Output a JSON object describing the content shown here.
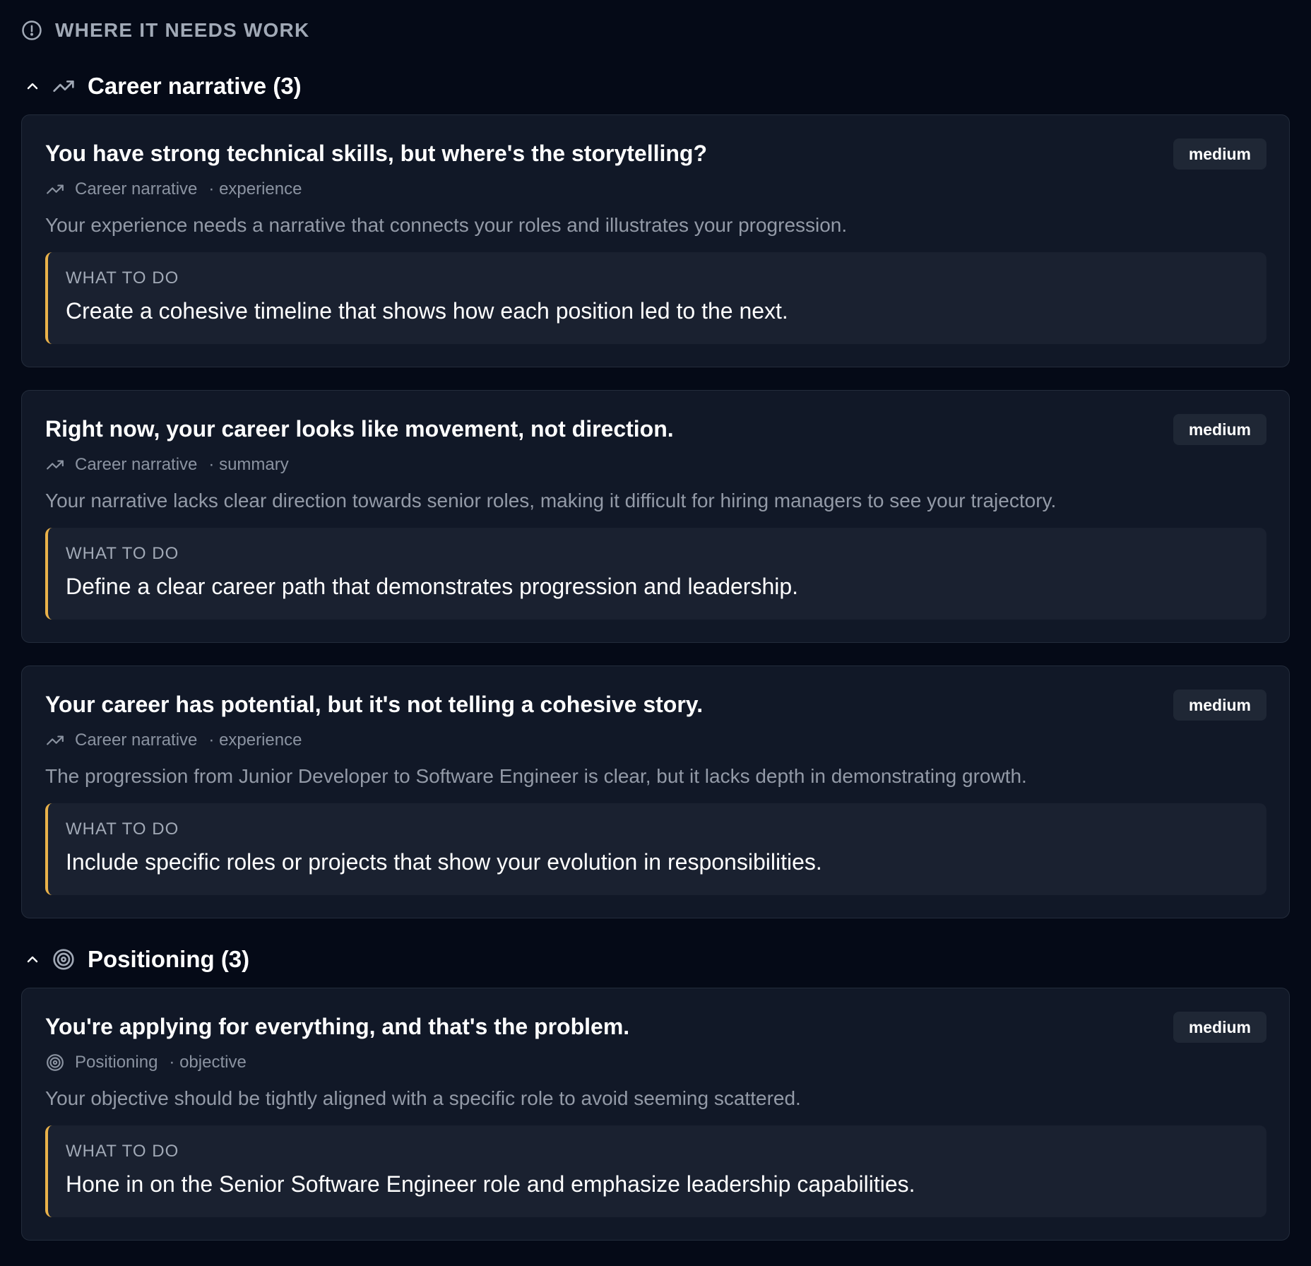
{
  "section": {
    "title": "WHERE IT NEEDS WORK",
    "icon": "alert-circle-icon"
  },
  "groups": [
    {
      "title": "Career narrative (3)",
      "icon": "trending-up-icon",
      "collapse_icon": "chevron-up-icon",
      "cards": [
        {
          "title": "You have strong technical skills, but where's the storytelling?",
          "severity": "medium",
          "category": "Career narrative",
          "tag": "· experience",
          "description": "Your experience needs a narrative that connects your roles and illustrates your progression.",
          "todo_label": "WHAT TO DO",
          "todo_text": "Create a cohesive timeline that shows how each position led to the next."
        },
        {
          "title": "Right now, your career looks like movement, not direction.",
          "severity": "medium",
          "category": "Career narrative",
          "tag": "· summary",
          "description": "Your narrative lacks clear direction towards senior roles, making it difficult for hiring managers to see your trajectory.",
          "todo_label": "WHAT TO DO",
          "todo_text": "Define a clear career path that demonstrates progression and leadership."
        },
        {
          "title": "Your career has potential, but it's not telling a cohesive story.",
          "severity": "medium",
          "category": "Career narrative",
          "tag": "· experience",
          "description": "The progression from Junior Developer to Software Engineer is clear, but it lacks depth in demonstrating growth.",
          "todo_label": "WHAT TO DO",
          "todo_text": "Include specific roles or projects that show your evolution in responsibilities."
        }
      ]
    },
    {
      "title": "Positioning (3)",
      "icon": "target-icon",
      "collapse_icon": "chevron-up-icon",
      "cards": [
        {
          "title": "You're applying for everything, and that's the problem.",
          "severity": "medium",
          "category": "Positioning",
          "tag": "· objective",
          "description": "Your objective should be tightly aligned with a specific role to avoid seeming scattered.",
          "todo_label": "WHAT TO DO",
          "todo_text": "Hone in on the Senior Software Engineer role and emphasize leadership capabilities."
        }
      ]
    }
  ],
  "colors": {
    "background": "#050a17",
    "card": "#111827",
    "accent": "#eab24a",
    "muted_text": "#939aa7"
  }
}
